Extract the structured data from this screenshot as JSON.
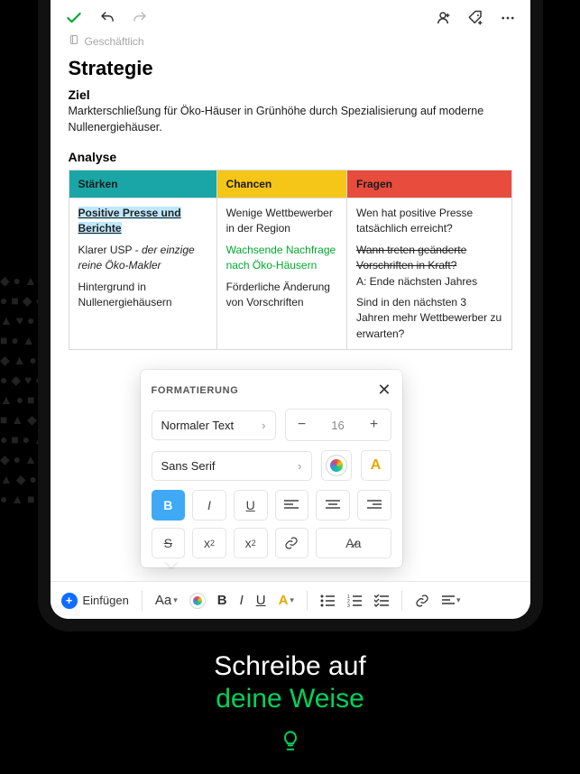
{
  "notebook": "Geschäftlich",
  "title": "Strategie",
  "section1": "Ziel",
  "goal": "Markterschließung für Öko-Häuser in Grünhöhe durch Spezialisierung auf moderne Nullenergiehäuser.",
  "section2": "Analyse",
  "table": {
    "h1": "Stärken",
    "h2": "Chancen",
    "h3": "Fragen",
    "c1a": "Positive Presse und Berichte",
    "c1b_pre": "Klarer USP - ",
    "c1b_em": "der einzige reine Öko-Makler",
    "c1c": "Hintergrund in Nullenergiehäusern",
    "c2a": "Wenige Wettbewerber in der Region",
    "c2b": "Wachsende Nachfrage nach Öko-Häusern",
    "c2c": "Förderliche Änderung von Vorschriften",
    "c3a": "Wen hat positive Presse tatsächlich erreicht?",
    "c3b": "Wann treten geänderte Vorschriften in Kraft?",
    "c3c": "A: Ende nächsten Jahres",
    "c3d": "Sind in den nächsten 3 Jahren mehr Wettbewerber zu erwarten?"
  },
  "popover": {
    "title": "FORMATIERUNG",
    "style": "Normaler Text",
    "font": "Sans Serif",
    "size": "16"
  },
  "toolbar": {
    "insert": "Einfügen"
  },
  "caption": {
    "l1": "Schreibe auf",
    "l2": "deine Weise"
  }
}
